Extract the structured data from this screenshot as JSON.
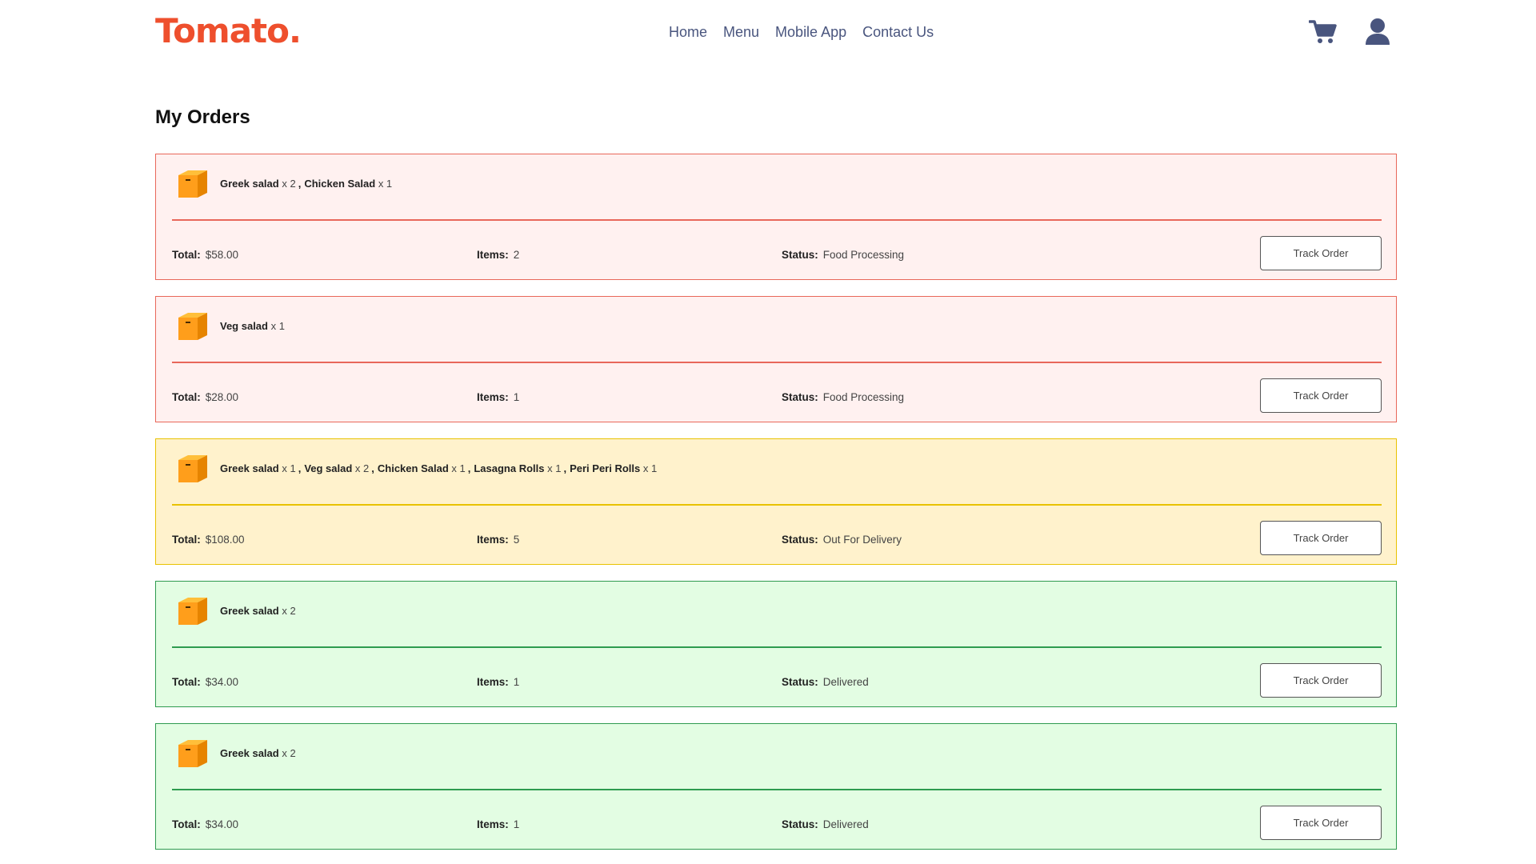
{
  "brand": {
    "logo": "Tomato.",
    "accent": "#ee4f2d",
    "nav_color": "#49557e"
  },
  "nav": {
    "links": [
      "Home",
      "Menu",
      "Mobile App",
      "Contact Us"
    ],
    "icons": [
      "cart-icon",
      "user-icon"
    ]
  },
  "page": {
    "title": "My Orders"
  },
  "labels": {
    "total": "Total:",
    "items": "Items:",
    "status": "Status:",
    "track_button": "Track Order"
  },
  "status_colors": {
    "Food Processing": "#e8675a",
    "Out For Delivery": "#e8c200",
    "Delivered": "#2e9b4f"
  },
  "orders": [
    {
      "items": [
        {
          "name": "Greek salad",
          "qty": "x 2"
        },
        {
          "name": "Chicken Salad",
          "qty": "x 1"
        }
      ],
      "total": "$58.00",
      "item_count": "2",
      "status": "Food Processing"
    },
    {
      "items": [
        {
          "name": "Veg salad",
          "qty": "x 1"
        }
      ],
      "total": "$28.00",
      "item_count": "1",
      "status": "Food Processing"
    },
    {
      "items": [
        {
          "name": "Greek salad",
          "qty": "x 1"
        },
        {
          "name": "Veg salad",
          "qty": "x 2"
        },
        {
          "name": "Chicken Salad",
          "qty": "x 1"
        },
        {
          "name": "Lasagna Rolls",
          "qty": "x 1"
        },
        {
          "name": "Peri Peri Rolls",
          "qty": "x 1"
        }
      ],
      "total": "$108.00",
      "item_count": "5",
      "status": "Out For Delivery"
    },
    {
      "items": [
        {
          "name": "Greek salad",
          "qty": "x 2"
        }
      ],
      "total": "$34.00",
      "item_count": "1",
      "status": "Delivered"
    },
    {
      "items": [
        {
          "name": "Greek salad",
          "qty": "x 2"
        }
      ],
      "total": "$34.00",
      "item_count": "1",
      "status": "Delivered"
    }
  ]
}
